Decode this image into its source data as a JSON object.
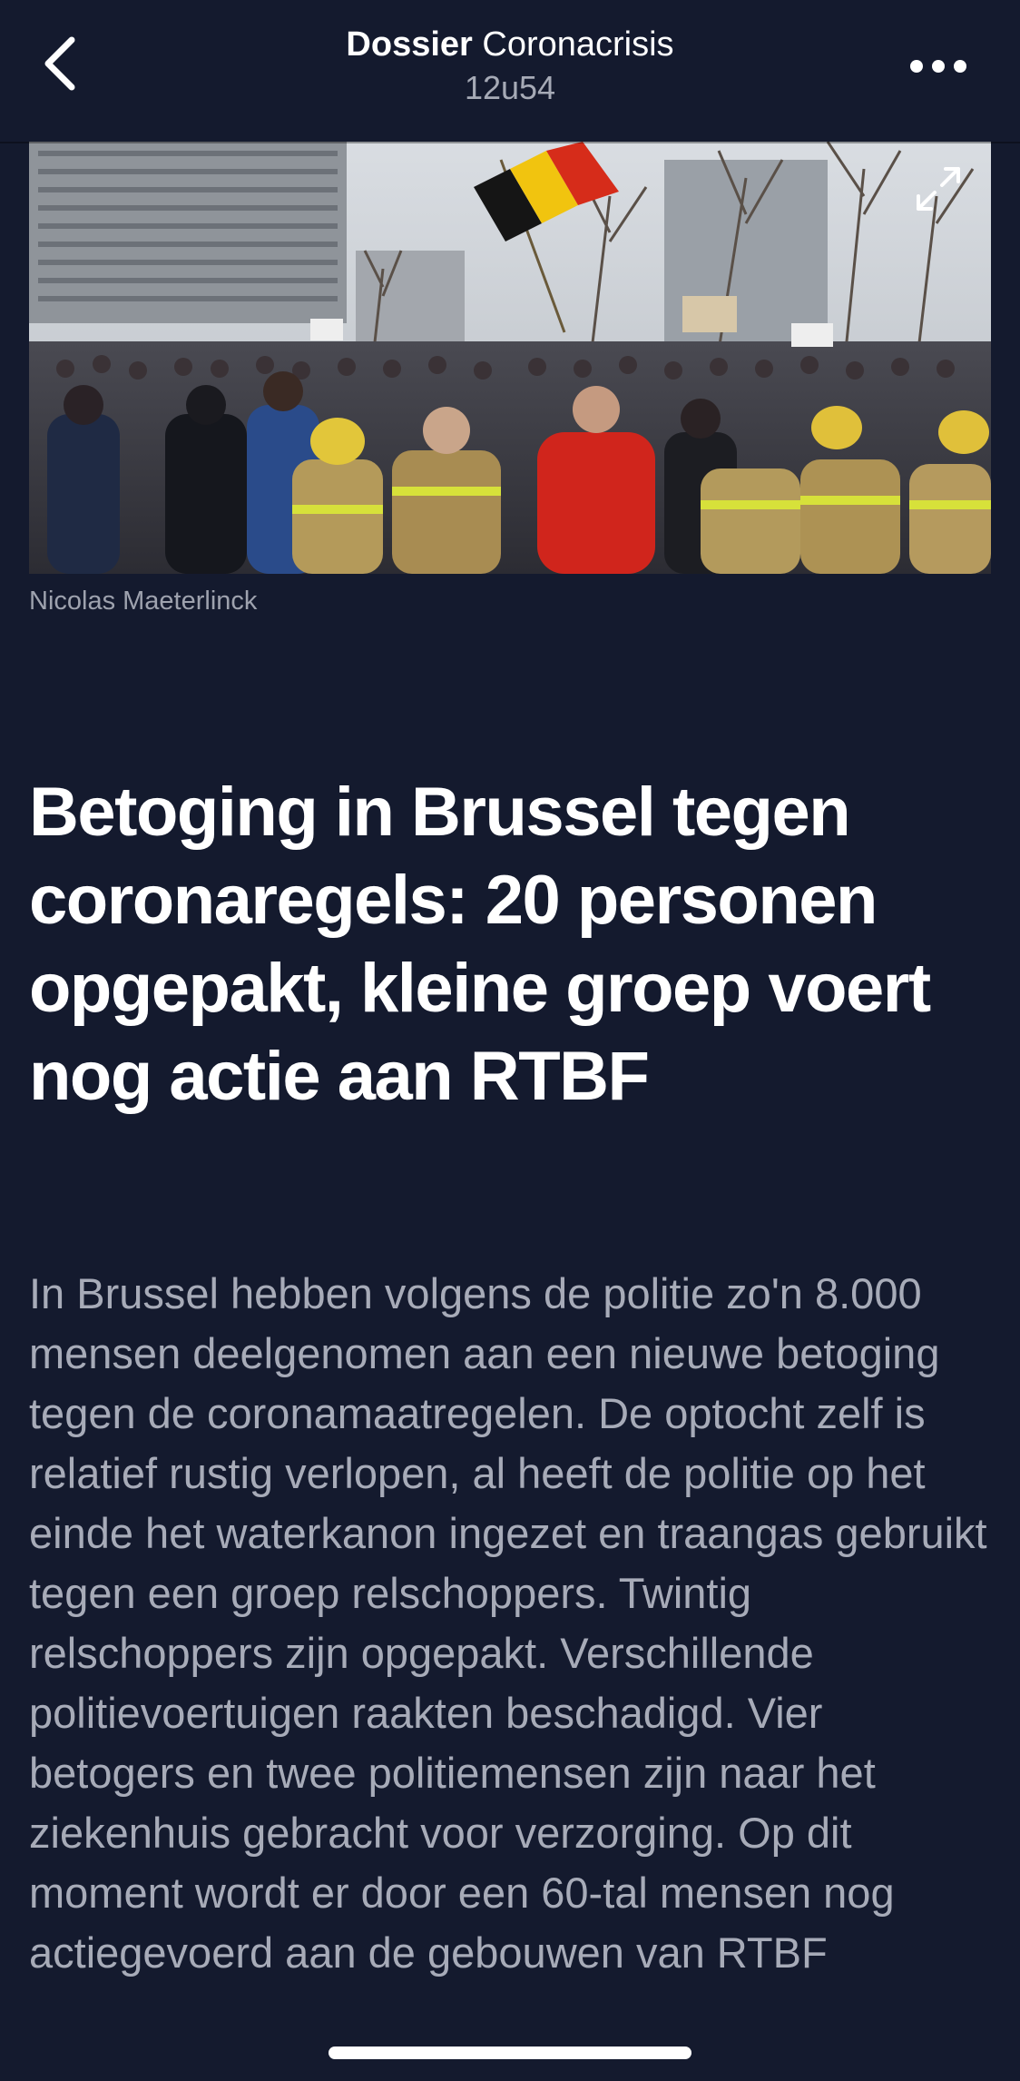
{
  "header": {
    "title_bold": "Dossier",
    "title_light": "Coronacrisis",
    "time": "12u54",
    "back_icon": "chevron-left-icon",
    "more_icon": "more-dots-icon"
  },
  "article": {
    "photo_caption": "Nicolas Maeterlinck",
    "expand_icon": "expand-icon",
    "headline": "Betoging in Brussel tegen coronaregels: 20 personen opgepakt, kleine groep voert nog actie aan RTBF",
    "lead": "In Brussel hebben volgens de politie zo'n 8.000 mensen deelgenomen aan een nieuwe betoging tegen de coronamaatregelen. De optocht zelf is relatief rustig verlopen, al heeft de politie op het einde het waterkanon ingezet en traangas gebruikt tegen een groep relschoppers. Twintig relschoppers zijn opgepakt. Verschillende politievoertuigen raakten beschadigd. Vier betogers en twee politiemensen zijn naar het ziekenhuis gebracht voor verzorging. Op dit moment wordt er door een 60-tal mensen nog actiegevoerd aan de gebouwen van RTBF"
  },
  "colors": {
    "background": "#141a2e",
    "text_primary": "#ffffff",
    "text_secondary": "#a7abb8"
  }
}
